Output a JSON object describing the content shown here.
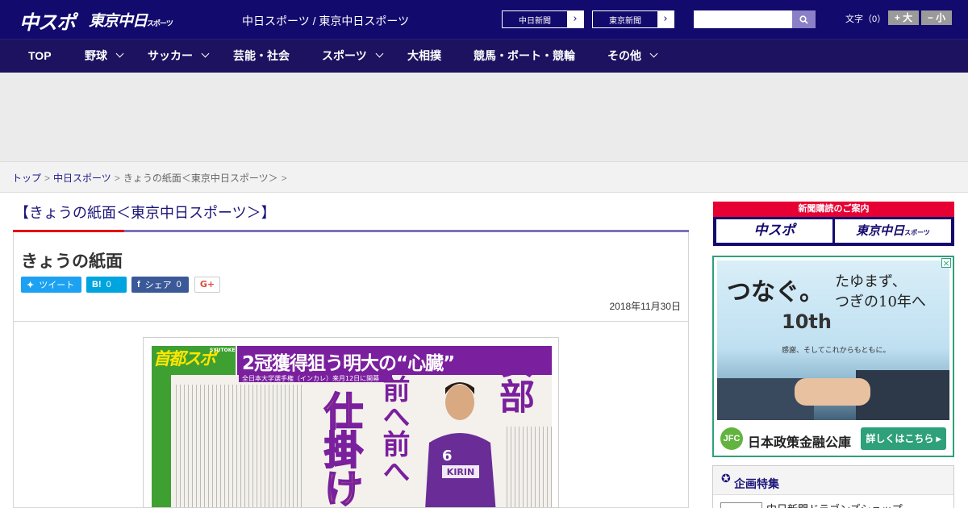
{
  "header": {
    "logo_primary": "中スポ",
    "logo_secondary": "東京中日",
    "logo_secondary_small": "スポーツ",
    "site_title": "中日スポーツ / 東京中日スポーツ",
    "ext_links": [
      {
        "label": "中日新聞"
      },
      {
        "label": "東京新聞"
      }
    ],
    "search": {
      "value": "",
      "placeholder": ""
    },
    "font_size": {
      "label": "文字（0）",
      "larger": "+ 大",
      "smaller": "− 小"
    }
  },
  "nav": {
    "items": [
      {
        "label": "TOP",
        "has_menu": false
      },
      {
        "label": "野球",
        "has_menu": true
      },
      {
        "label": "サッカー",
        "has_menu": true
      },
      {
        "label": "芸能・社会",
        "has_menu": false
      },
      {
        "label": "スポーツ",
        "has_menu": true
      },
      {
        "label": "大相撲",
        "has_menu": false
      },
      {
        "label": "競馬・ボート・競輪",
        "has_menu": false
      },
      {
        "label": "その他",
        "has_menu": true
      }
    ]
  },
  "breadcrumb": {
    "items": [
      "トップ",
      "中日スポーツ",
      "きょうの紙面＜東京中日スポーツ＞"
    ],
    "separator": ">"
  },
  "article": {
    "page_heading": "【きょうの紙面＜東京中日スポーツ＞】",
    "title": "きょうの紙面",
    "share": {
      "tweet": "ツイート",
      "hatena_icon": "B!",
      "hatena_count": "0",
      "facebook": "シェア",
      "facebook_count": "0",
      "gplus": "G+"
    },
    "date": "2018年11月30日"
  },
  "newspaper": {
    "masthead": "首都スポ",
    "masthead_sub": "SYUTOKEN SPORTS",
    "headline": "2冠獲得狙う明大の“心臓”",
    "subline": "全日本大学選手権（インカレ）来月12日に開幕",
    "name": "安部",
    "big_1": "前へ前へ",
    "big_2": "仕掛け"
  },
  "sidebar": {
    "subscribe": {
      "title": "新聞購読のご案内",
      "left": "中スポ",
      "right": "東京中日",
      "right_small": "スポーツ"
    },
    "ad": {
      "line1": "つなぐ。",
      "line2": "たゆまず、",
      "line3": "つぎの10年へ",
      "anniversary": "10th",
      "tagline": "感謝、そしてこれからもともに。",
      "badge": "JFC",
      "advertiser": "日本政策金融公庫",
      "cta": "詳しくはこちら ▸",
      "close": "×"
    },
    "feature": {
      "title": "企画特集",
      "item": "中日新聞ドラゴンズショップ"
    }
  },
  "colors": {
    "header_bg": "#130a6e",
    "nav_bg": "#1c125f",
    "accent_red": "#e60012",
    "heading_blue": "#1a1478",
    "twitter": "#1da1f2",
    "hatena": "#00a4de",
    "facebook": "#3b5998",
    "jfc_green": "#2ea07a"
  },
  "icons": {
    "search": "search-icon",
    "chevron": "chevron-right-icon",
    "nav_menu": "chevron-down-icon",
    "twitter": "twitter-icon",
    "facebook": "facebook-icon",
    "feature": "ribbon-icon"
  }
}
